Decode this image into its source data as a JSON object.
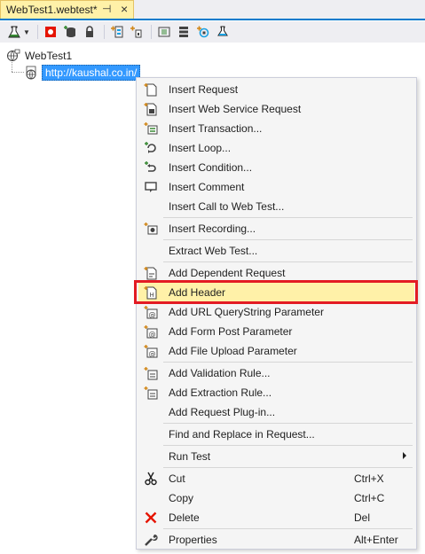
{
  "tab": {
    "title": "WebTest1.webtest*",
    "pin_glyph": "⊣",
    "close_glyph": "×",
    "active_color": "#fff1a8",
    "accent": "#007acc"
  },
  "toolbar": {
    "buttons": [
      "add-test-icon",
      "record-icon",
      "add-datasource-icon",
      "credentials-icon",
      "parameterize-icon",
      "add-plugin-icon",
      "settings-icon",
      "generate-code-icon",
      "context-icon",
      "run-icon"
    ]
  },
  "tree": {
    "root_label": "WebTest1",
    "child_label": "http://kaushal.co.in/",
    "selection_color": "#3399ff"
  },
  "menu": {
    "items": [
      {
        "label": "Insert Request",
        "icon": "insert-request-icon"
      },
      {
        "label": "Insert Web Service Request",
        "icon": "insert-webservice-icon"
      },
      {
        "label": "Insert Transaction...",
        "icon": "insert-transaction-icon"
      },
      {
        "label": "Insert Loop...",
        "icon": "insert-loop-icon"
      },
      {
        "label": "Insert Condition...",
        "icon": "insert-condition-icon"
      },
      {
        "label": "Insert Comment",
        "icon": "insert-comment-icon"
      },
      {
        "label": "Insert Call to Web Test...",
        "icon": ""
      },
      {
        "label": "Insert Recording...",
        "icon": "insert-recording-icon"
      },
      {
        "label": "Extract Web Test...",
        "icon": ""
      },
      {
        "label": "Add Dependent Request",
        "icon": "add-dependent-request-icon"
      },
      {
        "label": "Add Header",
        "icon": "add-header-icon"
      },
      {
        "label": "Add URL QueryString Parameter",
        "icon": "add-querystring-icon"
      },
      {
        "label": "Add Form Post Parameter",
        "icon": "add-form-post-icon"
      },
      {
        "label": "Add File Upload Parameter",
        "icon": "add-file-upload-icon"
      },
      {
        "label": "Add Validation Rule...",
        "icon": "add-validation-rule-icon"
      },
      {
        "label": "Add Extraction Rule...",
        "icon": "add-extraction-rule-icon"
      },
      {
        "label": "Add Request Plug-in...",
        "icon": ""
      },
      {
        "label": "Find and Replace in Request...",
        "icon": ""
      },
      {
        "label": "Run Test",
        "icon": ""
      },
      {
        "label": "Cut",
        "icon": "cut-icon",
        "shortcut": "Ctrl+X"
      },
      {
        "label": "Copy",
        "icon": "copy-icon",
        "shortcut": "Ctrl+C"
      },
      {
        "label": "Delete",
        "icon": "delete-icon",
        "shortcut": "Del"
      },
      {
        "label": "Properties",
        "icon": "properties-icon",
        "shortcut": "Alt+Enter"
      }
    ],
    "highlighted_item": "Add Header",
    "highlight_color": "#fff1a8",
    "callout_color": "#e31b23"
  }
}
